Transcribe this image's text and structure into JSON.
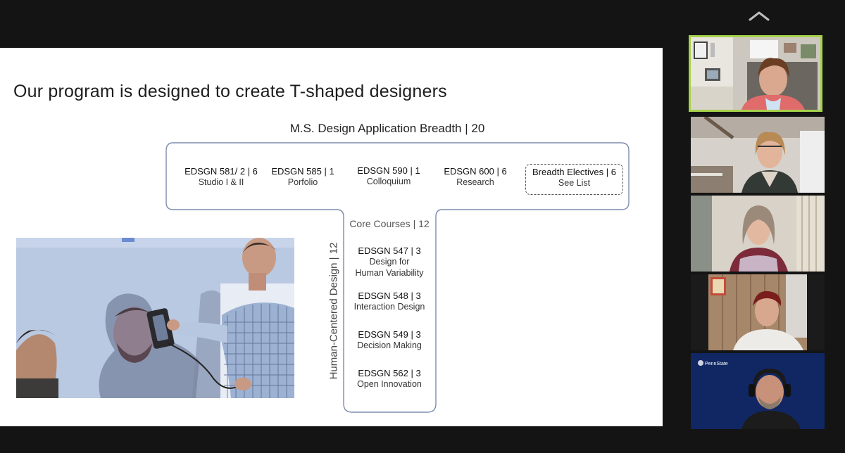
{
  "slide": {
    "title": "Our program is designed to create T-shaped designers",
    "breadth_heading": "M.S. Design Application Breadth  | 20",
    "breadth_courses": [
      {
        "code": "EDSGN 581/ 2 | 6",
        "name": "Studio I & II"
      },
      {
        "code": "EDSGN 585 | 1",
        "name": "Porfolio"
      },
      {
        "code": "EDSGN 590 | 1",
        "name": "Colloquium"
      },
      {
        "code": "EDSGN 600 | 6",
        "name": "Research"
      },
      {
        "code": "Breadth Electives | 6",
        "name": "See List"
      }
    ],
    "core_heading": "Core Courses | 12",
    "vertical_label": "Human-Centered Design  |  12",
    "core_courses": [
      {
        "code": "EDSGN 547 | 3",
        "name_line1": "Design for",
        "name_line2": "Human Variability"
      },
      {
        "code": "EDSGN 548 | 3",
        "name_line1": "Interaction Design",
        "name_line2": ""
      },
      {
        "code": "EDSGN 549 | 3",
        "name_line1": "Decision Making",
        "name_line2": ""
      },
      {
        "code": "EDSGN 562 | 3",
        "name_line1": "Open Innovation",
        "name_line2": ""
      }
    ]
  },
  "participants": {
    "active_border_color": "#a7d24b",
    "logo_text": "PennState"
  },
  "icons": {
    "collapse": "chevron-up-icon"
  }
}
